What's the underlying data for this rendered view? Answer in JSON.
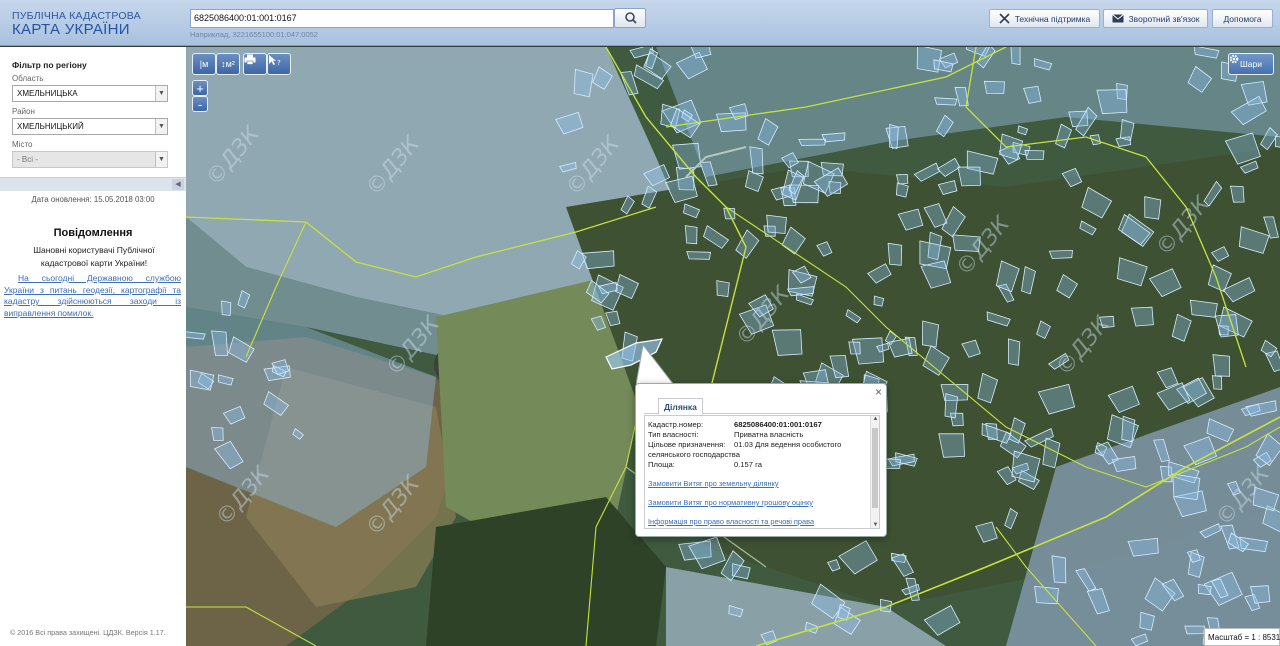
{
  "header": {
    "logo_top": "ПУБЛІЧНА КАДАСТРОВА",
    "logo_main": "КАРТА УКРАЇНИ",
    "search_value": "6825086400:01:001:0167",
    "search_hint": "Наприклад, 3221655100:01:047:0052",
    "search_icon": "search-icon",
    "buttons": {
      "support": "Технічна підтримка",
      "feedback": "Зворотний зв'язок",
      "help": "Допомога"
    }
  },
  "sidebar": {
    "filter_title": "Фільтр по регіону",
    "region_label": "Область",
    "region_value": "ХМЕЛЬНИЦЬКА",
    "district_label": "Район",
    "district_value": "ХМЕЛЬНИЦЬКИЙ",
    "city_label": "Місто",
    "city_value": "- Всі -",
    "collapse_glyph": "◀",
    "update_date": "Дата оновлення: 15.05.2018 03:00",
    "notice_title": "Повідомлення",
    "notice_greeting": "Шановні користувачі Публічної кадастрової карти України!",
    "notice_text": "На сьогодні Державною службою України з питань геодезії, картографії та кадастру здійснюються заходи із виправлення помилок.",
    "copyright": "© 2016 Всі права захищені. ЦДЗК. Версія 1.17."
  },
  "map": {
    "toolbar": {
      "measure_line": "|м",
      "measure_area": "↕м²",
      "print_icon": "print-icon",
      "identify_icon": "identify-icon",
      "zoom_in": "+",
      "zoom_out": "-"
    },
    "layers_label": "Шари",
    "scale": "Масштаб = 1 : 8531",
    "watermark": "©ДЗК"
  },
  "popup": {
    "tab": "Ділянка",
    "close": "×",
    "fields": [
      {
        "label": "Кадастр.номер:",
        "value": "6825086400:01:001:0167"
      },
      {
        "label": "Тип власності:",
        "value": "Приватна власність"
      },
      {
        "label": "Цільове призначення:",
        "value": "01.03 Для ведення особистого"
      },
      {
        "label": "",
        "value": "селянського господарства"
      },
      {
        "label": "Площа:",
        "value": "0.157 га"
      }
    ],
    "links": [
      "Замовити Витяг про земельну ділянку",
      "Замовити Витяг про нормативну грошову оцінку",
      "Інформація про право власності та речові права"
    ]
  },
  "colors": {
    "header_bg": "#b8cce6",
    "parcel_fill": "#8fc4f0",
    "parcel_stroke": "#cfe9ff",
    "boundary": "#b9f03a",
    "link": "#3b6fb6"
  }
}
